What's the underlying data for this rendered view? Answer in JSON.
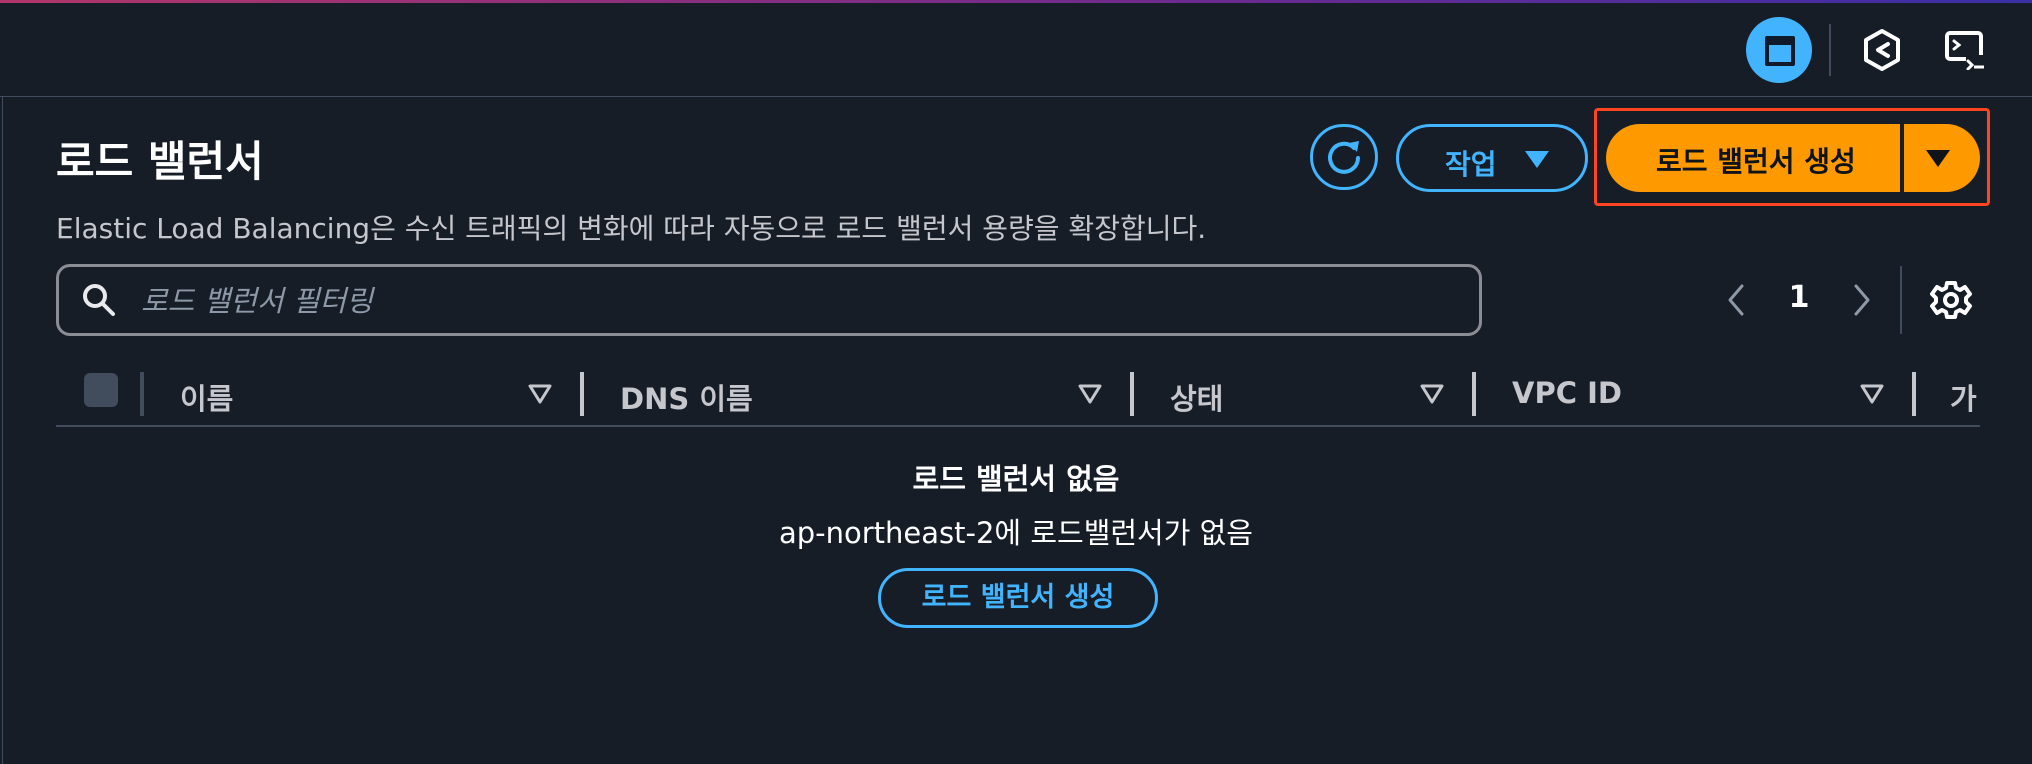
{
  "topbar": {
    "buttons": [
      {
        "icon": "panel-layout-icon",
        "active": true
      },
      {
        "icon": "hexagon-app-icon"
      },
      {
        "icon": "terminal-screen-icon"
      }
    ]
  },
  "header": {
    "title": "로드 밸런서",
    "description": "Elastic Load Balancing은 수신 트래픽의 변화에 따라 자동으로 로드 밸런서 용량을 확장합니다.",
    "refresh_icon": "refresh-icon",
    "actions_label": "작업",
    "create_label": "로드 밸런서 생성"
  },
  "filter": {
    "placeholder": "로드 밸런서 필터링",
    "icon": "search-icon"
  },
  "pagination": {
    "current_page": "1"
  },
  "table": {
    "columns": [
      "이름",
      "DNS 이름",
      "상태",
      "VPC ID",
      "가"
    ],
    "empty_title": "로드 밸런서 없음",
    "empty_message": "ap-northeast-2에 로드밸런서가 없음",
    "empty_button": "로드 밸런서 생성"
  },
  "colors": {
    "background": "#161d26",
    "accent_blue": "#42b4ff",
    "primary_orange": "#ff9900",
    "highlight_red": "#ff4422"
  }
}
